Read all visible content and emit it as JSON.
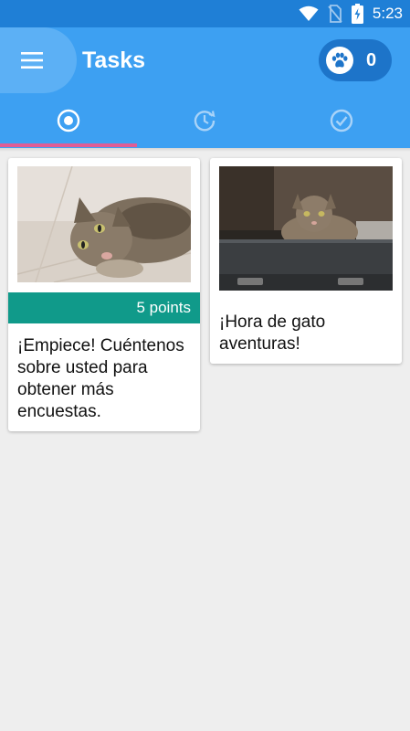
{
  "status_bar": {
    "time": "5:23",
    "icons": [
      "wifi-icon",
      "no-sim-icon",
      "battery-charging-icon"
    ]
  },
  "app_bar": {
    "title": "Tasks",
    "menu_icon": "menu-icon",
    "points_icon": "paw-icon",
    "points_count": "0"
  },
  "tabs": [
    {
      "icon": "target-icon",
      "selected": true
    },
    {
      "icon": "history-icon",
      "selected": false
    },
    {
      "icon": "check-circle-icon",
      "selected": false
    }
  ],
  "colors": {
    "status_bar": "#1f7fd6",
    "app_bar": "#3da0f2",
    "tab_indicator": "#e05d95",
    "points_strip": "#109a8a",
    "background": "#eeeeee"
  },
  "cards": [
    {
      "image": "cat-lying-on-floor-photo",
      "points": "5 points",
      "text": "¡Empiece! Cuéntenos sobre usted para obtener más encuestas."
    },
    {
      "image": "cat-in-suitcase-photo",
      "text": "¡Hora de gato aventuras!"
    }
  ]
}
